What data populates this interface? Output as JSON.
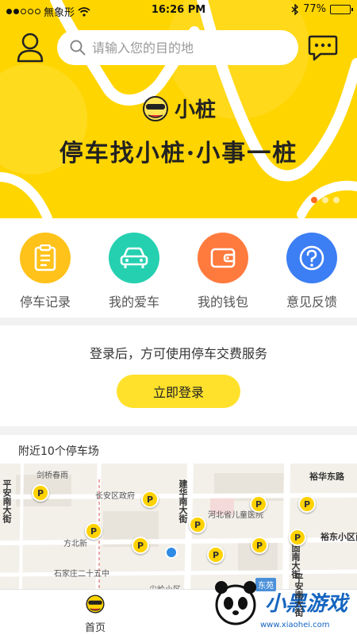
{
  "status_bar": {
    "carrier": "無象形",
    "time": "16:26 PM",
    "battery": "77%",
    "battery_level": 0.77
  },
  "search": {
    "placeholder": "请输入您的目的地"
  },
  "banner": {
    "brand": "小桩",
    "slogan": "停车找小桩·小事一桩",
    "slide_count": 3,
    "active_slide": 1
  },
  "menu": {
    "items": [
      {
        "label": "停车记录",
        "icon": "clipboard-icon",
        "color": "#FFC21A"
      },
      {
        "label": "我的爱车",
        "icon": "car-icon",
        "color": "#25D0B0"
      },
      {
        "label": "我的钱包",
        "icon": "wallet-icon",
        "color": "#FF7A3D"
      },
      {
        "label": "意见反馈",
        "icon": "question-icon",
        "color": "#3C7EF4"
      }
    ]
  },
  "login": {
    "message": "登录后，方可使用停车交费服务",
    "button": "立即登录"
  },
  "nearby": {
    "title": "附近10个停车场",
    "map_labels": {
      "l1": "剑桥春雨",
      "l2": "长安区政府",
      "l3": "方北新",
      "l4": "石家庄二十五中",
      "l5": "尖岭小区",
      "l6": "建华南大街",
      "l7": "河北省儿童医院",
      "l8": "裕华东路",
      "l9": "裕东小区西",
      "l10": "谈固南大街",
      "l11": "平安南大街",
      "l12": "东苑"
    },
    "pin_label": "P"
  },
  "tabbar": {
    "home": "首页"
  },
  "watermark": {
    "brand": "小黑游戏",
    "url": "www.xiaohei.com"
  },
  "colors": {
    "accent": "#FFD500",
    "button": "#FFE12C",
    "pager_active": "#FF6A1F"
  }
}
